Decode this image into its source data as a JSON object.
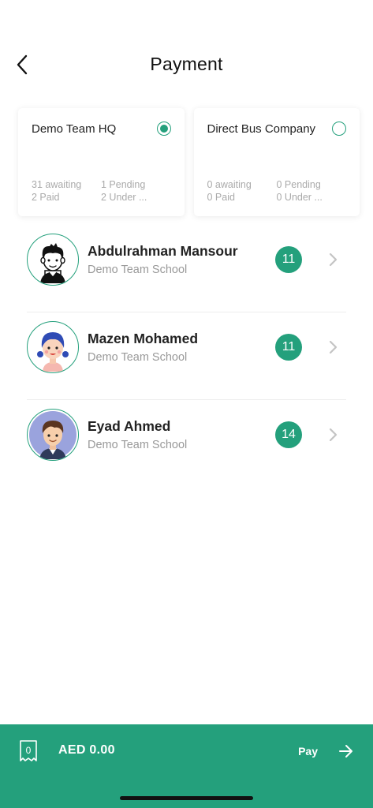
{
  "header": {
    "title": "Payment"
  },
  "companies": [
    {
      "name": "Demo Team HQ",
      "selected": true,
      "awaiting": "31 awaiting",
      "pending": "1 Pending",
      "paid": "2 Paid",
      "under": "2 Under ..."
    },
    {
      "name": "Direct Bus Company",
      "selected": false,
      "awaiting": "0 awaiting",
      "pending": "0 Pending",
      "paid": "0 Paid",
      "under": "0 Under ..."
    }
  ],
  "students": [
    {
      "name": "Abdulrahman Mansour",
      "school": "Demo Team School",
      "count": "11",
      "avatar": "boy-avatar-icon"
    },
    {
      "name": "Mazen Mohamed",
      "school": "Demo Team School",
      "count": "11",
      "avatar": "girl-avatar-icon"
    },
    {
      "name": "Eyad Ahmed",
      "school": "Demo Team School",
      "count": "14",
      "avatar": "boy-avatar-icon"
    }
  ],
  "footer": {
    "receipt_count": "0",
    "amount": "AED 0.00",
    "pay_label": "Pay"
  },
  "colors": {
    "accent": "#24a07c",
    "footer_bg": "#24a07c"
  }
}
